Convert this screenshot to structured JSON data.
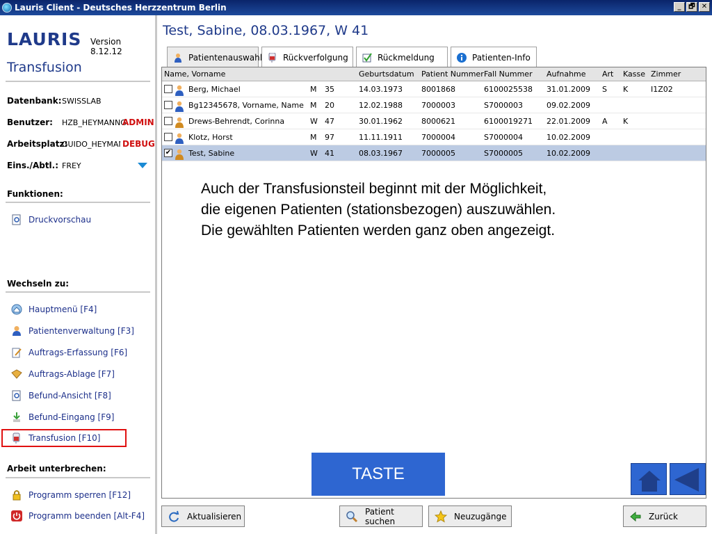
{
  "window": {
    "title": "Lauris Client - Deutsches Herzzentrum Berlin",
    "min": "_",
    "max": "🗗",
    "close": "✕"
  },
  "sidebar": {
    "logo": "LAURIS",
    "version": "Version 8.12.12",
    "app_name": "Transfusion",
    "info": {
      "db_label": "Datenbank:",
      "db_value": "SWISSLAB",
      "user_label": "Benutzer:",
      "user_value": "HZB_HEYMANNG",
      "user_tag": "ADMIN",
      "ws_label": "Arbeitsplatz:",
      "ws_value": "GUIDO_HEYMAN",
      "ws_tag": "DEBUG",
      "dept_label": "Eins./Abtl.:",
      "dept_value": "FREY"
    },
    "functions_title": "Funktionen:",
    "functions": [
      {
        "label": "Druckvorschau",
        "icon": "print-preview-icon"
      }
    ],
    "switch_title": "Wechseln zu:",
    "switch_items": [
      {
        "label": "Hauptmenü [F4]",
        "icon": "home-icon"
      },
      {
        "label": "Patientenverwaltung [F3]",
        "icon": "patient-icon"
      },
      {
        "label": "Auftrags-Erfassung [F6]",
        "icon": "order-entry-icon"
      },
      {
        "label": "Auftrags-Ablage [F7]",
        "icon": "order-archive-icon"
      },
      {
        "label": "Befund-Ansicht [F8]",
        "icon": "report-view-icon"
      },
      {
        "label": "Befund-Eingang [F9]",
        "icon": "report-inbox-icon"
      },
      {
        "label": "Transfusion [F10]",
        "icon": "transfusion-icon"
      }
    ],
    "interrupt_title": "Arbeit unterbrechen:",
    "interrupt_items": [
      {
        "label": "Programm sperren [F12]",
        "icon": "lock-icon"
      },
      {
        "label": "Programm beenden [Alt-F4]",
        "icon": "power-icon"
      }
    ]
  },
  "main": {
    "title": "Test, Sabine, 08.03.1967, W 41",
    "tabs": [
      {
        "label": "Patientenauswahl",
        "icon": "patient-icon"
      },
      {
        "label": "Rückverfolgung",
        "icon": "blood-bag-icon"
      },
      {
        "label": "Rückmeldung",
        "icon": "check-icon"
      },
      {
        "label": "Patienten-Info",
        "icon": "info-icon"
      }
    ],
    "columns": [
      "Name,  Vorname",
      "Geburtsdatum",
      "Patient Nummer",
      "Fall Nummer",
      "Aufnahme",
      "Art",
      "Kasse",
      "Zimmer"
    ],
    "rows": [
      {
        "checked": false,
        "gender_icon": "male",
        "name": "Berg,  Michael",
        "sex": "M",
        "age": "35",
        "dob": "14.03.1973",
        "pat_nr": "8001868",
        "case_nr": "6100025538",
        "admission": "31.01.2009",
        "art": "S",
        "kasse": "K",
        "room": "I1Z02"
      },
      {
        "checked": false,
        "gender_icon": "male",
        "name": "Bg12345678,  Vorname, Name",
        "sex": "M",
        "age": "20",
        "dob": "12.02.1988",
        "pat_nr": "7000003",
        "case_nr": "S7000003",
        "admission": "09.02.2009",
        "art": "",
        "kasse": "",
        "room": ""
      },
      {
        "checked": false,
        "gender_icon": "female",
        "name": "Drews-Behrendt,  Corinna",
        "sex": "W",
        "age": "47",
        "dob": "30.01.1962",
        "pat_nr": "8000621",
        "case_nr": "6100019271",
        "admission": "22.01.2009",
        "art": "A",
        "kasse": "K",
        "room": ""
      },
      {
        "checked": false,
        "gender_icon": "male",
        "name": "Klotz,  Horst",
        "sex": "M",
        "age": "97",
        "dob": "11.11.1911",
        "pat_nr": "7000004",
        "case_nr": "S7000004",
        "admission": "10.02.2009",
        "art": "",
        "kasse": "",
        "room": ""
      },
      {
        "checked": true,
        "gender_icon": "female",
        "name": "Test,  Sabine",
        "sex": "W",
        "age": "41",
        "dob": "08.03.1967",
        "pat_nr": "7000005",
        "case_nr": "S7000005",
        "admission": "10.02.2009",
        "art": "",
        "kasse": "",
        "room": ""
      }
    ],
    "message": [
      "Auch der Transfusionsteil beginnt mit der Möglichkeit,",
      "die eigenen Patienten (stationsbezogen) auszuwählen.",
      "Die gewählten Patienten werden ganz oben angezeigt."
    ],
    "taste": "TASTE"
  },
  "bottom": {
    "refresh": "Aktualisieren",
    "search": "Patient suchen",
    "new_arrivals": "Neuzugänge",
    "back": "Zurück"
  },
  "colors": {
    "accent": "#2e66d1",
    "title_blue": "#1f3a8a",
    "danger": "#d01010",
    "selected_row": "#bccbe3"
  }
}
